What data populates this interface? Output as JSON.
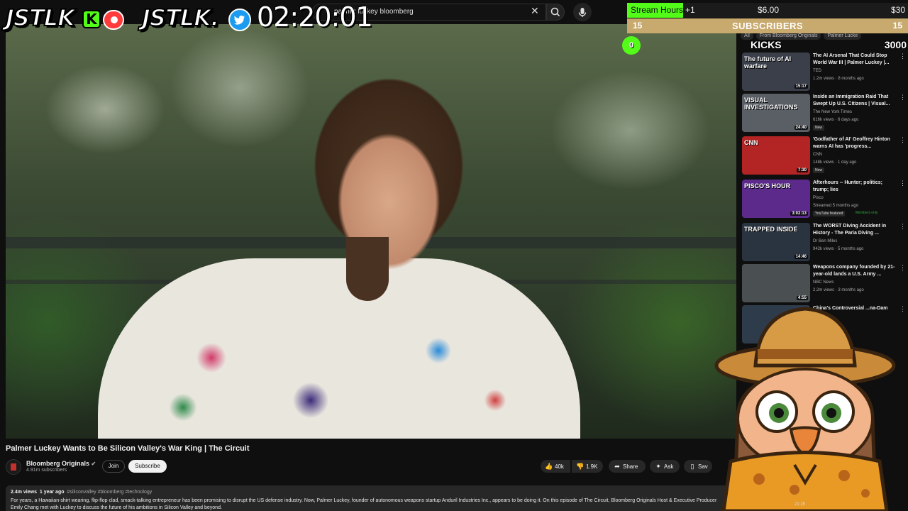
{
  "search": {
    "query": "palmer luckey bloomberg"
  },
  "overlay": {
    "logo_left": "JSTLK",
    "kick_letter": "K",
    "logo_right": "JSTLK.",
    "timer": "02:20:01",
    "stream_hours": {
      "label": "Stream Hours",
      "plus": "+1",
      "mid": "$6.00",
      "right": "$30",
      "progress": 0.2
    },
    "subscribers": {
      "left": "15",
      "label": "SUBSCRIBERS",
      "right": "15"
    },
    "kicks": {
      "label": "KICKS",
      "total": "3000",
      "current": "0"
    },
    "mascot_time": "21:29",
    "colors": {
      "kick_green": "#53fc18",
      "subs_gold": "#c8a96e",
      "twitter_blue": "#1d9bf0"
    }
  },
  "video": {
    "title": "Palmer Luckey Wants to Be Silicon Valley's War King | The Circuit",
    "channel": "Bloomberg Originals",
    "subscribers": "4.91m subscribers",
    "join": "Join",
    "subscribe": "Subscribe",
    "likes": "40k",
    "dislikes": "1.9K",
    "share": "Share",
    "ask": "Ask",
    "save": "Sav",
    "views": "2.4m views",
    "age": "1 year ago",
    "tags": "#siliconvalley #bloomberg #technology",
    "description": "For years, a Hawaiian-shirt wearing, flip-flop clad, smack-talking entrepreneur has been promising to disrupt the US defense industry. Now, Palmer Luckey, founder of autonomous weapons startup Anduril Industries Inc., appears to be doing it. On this episode of The Circuit, Bloomberg Originals Host & Executive Producer Emily Chang met with Luckey to discuss the future of his ambitions in Silicon Valley and beyond."
  },
  "chips": [
    "All",
    "From Bloomberg Originals",
    "Palmer Lucke"
  ],
  "recommendations": [
    {
      "title": "The AI Arsenal That Could Stop World War III | Palmer Luckey |...",
      "channel": "TED",
      "meta": "1.2m views · 8 months ago",
      "duration": "15:17",
      "overlay": "The future of AI warfare",
      "thumb": "#3a3f4a"
    },
    {
      "title": "Inside an Immigration Raid That Swept Up U.S. Citizens | Visual...",
      "channel": "The New York Times",
      "meta": "616k views · 6 days ago",
      "duration": "24:40",
      "overlay": "VISUAL INVESTIGATIONS",
      "badge": "New",
      "thumb": "#5a5f66"
    },
    {
      "title": "'Godfather of AI' Geoffrey Hinton warns AI has 'progress...",
      "channel": "CNN",
      "meta": "148k views · 1 day ago",
      "duration": "7:30",
      "overlay": "CNN",
      "badge": "New",
      "thumb": "#b32424"
    },
    {
      "title": "Afterhours -- Hunter; politics; trump; lies",
      "channel": "Pisco",
      "meta": "Streamed 5 months ago",
      "duration": "3:02:13",
      "overlay": "PISCO'S HOUR",
      "badge": "YouTube featured",
      "badge2": "Members only",
      "thumb": "#5b2a8a"
    },
    {
      "title": "The WORST Diving Accident in History - The Paria Diving ...",
      "channel": "Dr Ben Miles",
      "meta": "942k views · 5 months ago",
      "duration": "14:46",
      "overlay": "TRAPPED INSIDE",
      "thumb": "#2a3340"
    },
    {
      "title": "Weapons company founded by 21-year-old lands a U.S. Army ...",
      "channel": "NBC News",
      "meta": "2.2m views · 3 months ago",
      "duration": "4:55",
      "overlay": "",
      "thumb": "#4a4f52"
    },
    {
      "title": "China's Controversial ...na-Dam",
      "channel": "",
      "meta": "",
      "duration": "",
      "overlay": "",
      "thumb": "#2d3b4a"
    }
  ]
}
